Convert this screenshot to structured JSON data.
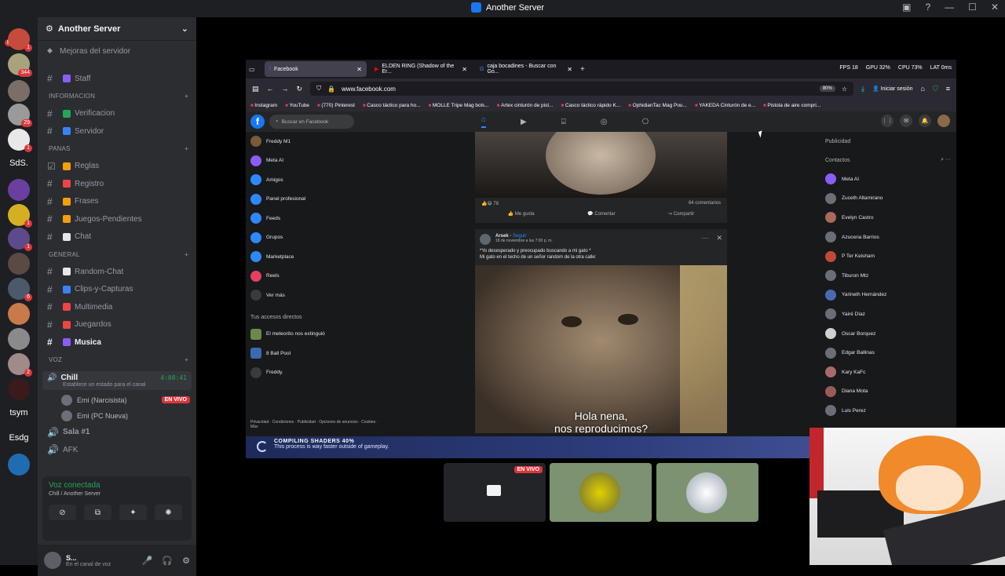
{
  "window": {
    "title": "Another Server"
  },
  "servers": {
    "nuevo_badge": "NUEVO",
    "text_items": [
      "SdS.",
      "tsym",
      "Esdg"
    ],
    "badges": [
      "1",
      "344",
      "29",
      "1",
      "1",
      "1",
      "6",
      "2"
    ]
  },
  "server": {
    "name": "Another Server",
    "boost": "Mejoras del servidor",
    "channels_top": [
      {
        "label": "Staff"
      }
    ],
    "categories": [
      {
        "name": "INFORMACION",
        "channels": [
          {
            "label": "Verificacion"
          },
          {
            "label": "Servidor"
          }
        ]
      },
      {
        "name": "PANAS",
        "channels": [
          {
            "label": "Reglas"
          },
          {
            "label": "Registro"
          },
          {
            "label": "Frases"
          },
          {
            "label": "Juegos-Pendientes"
          },
          {
            "label": "Chat"
          }
        ]
      },
      {
        "name": "GENERAL",
        "channels": [
          {
            "label": "Random-Chat"
          },
          {
            "label": "Clips-y-Capturas"
          },
          {
            "label": "Multimedia"
          },
          {
            "label": "Juegardos"
          },
          {
            "label": "Musica"
          }
        ]
      }
    ],
    "voice_category": "VOZ",
    "voice_channel": {
      "name": "Chill",
      "time": "4:08:41",
      "status": "Establece un estado para el canal"
    },
    "voice_users": [
      {
        "name": "Emi (Narcisista)",
        "live": "EN VIVO"
      },
      {
        "name": "Emi (PC Nueva)"
      }
    ],
    "other_voice": [
      {
        "name": "Sala #1"
      },
      {
        "name": "AFK"
      }
    ]
  },
  "voice_panel": {
    "title": "Voz conectada",
    "sub": "Chill / Another Server"
  },
  "user_panel": {
    "name": "S...",
    "status": "En el canal de voz"
  },
  "browser": {
    "tabs": [
      {
        "label": "Facebook"
      },
      {
        "label": "ELDEN RING (Shadow of the Er..."
      },
      {
        "label": "caja bocadines - Buscar con Go..."
      }
    ],
    "overlay": {
      "fps_label": "FPS",
      "fps": "18",
      "gpu": "GPU 32%",
      "cpu": "CPU 73%",
      "lat": "LAT 0ms"
    },
    "url": "www.facebook.com",
    "zoom": "80%",
    "signin": "Iniciar sesión",
    "bookmarks": [
      "Instagram",
      "YouTube",
      "(770) Pinterest",
      "Casco táctico para ho...",
      "MOLLE Tripe Mag bols...",
      "Artex cinturón de pist...",
      "Casco táctico rápido K...",
      "OphidianTac Mag Pou...",
      "YAKEDA Cinturón de e...",
      "Pistola de aire compri..."
    ]
  },
  "facebook": {
    "search_placeholder": "Buscar en Facebook",
    "left_nav": [
      {
        "label": "Freddy M1"
      },
      {
        "label": "Meta AI"
      },
      {
        "label": "Amigos"
      },
      {
        "label": "Panel profesional"
      },
      {
        "label": "Feeds"
      },
      {
        "label": "Grupos"
      },
      {
        "label": "Marketplace"
      },
      {
        "label": "Reels"
      },
      {
        "label": "Ver más"
      }
    ],
    "shortcuts_title": "Tus accesos directos",
    "shortcuts": [
      {
        "label": "El meteorito nos extinguió"
      },
      {
        "label": "8 Ball Pool"
      },
      {
        "label": "Freddy."
      }
    ],
    "footer": "Privacidad · Condiciones · Publicidad · Opciones de anuncios · Cookies · Más",
    "post1": {
      "reactions": "78",
      "comments": "64 comentarios",
      "like": "Me gusta",
      "comment": "Comentar",
      "share": "Compartir"
    },
    "post2": {
      "author": "Arsek",
      "follow": "Seguir",
      "date": "18 de noviembre a las 7:00 p. m.",
      "text1": "*Yo desesperado y preocupado buscando a mi gato *",
      "text2": "Mi gato en el techo de un señor random de la otra calle:",
      "caption1": "Hola nena,",
      "caption2": "nos reproducimos?"
    },
    "right": {
      "ads": "Publicidad",
      "contacts": "Contactos",
      "list": [
        "Meta AI",
        "Zuceth Altamirano",
        "Evelyn Castro",
        "Azucena Barrios",
        "P Ter Keisham",
        "Tiburon Mtz",
        "Yarineth Hernández",
        "Yairé Díaz",
        "Oscar Borquez",
        "Edgar Ballinas",
        "Kary KaFc",
        "Diana Mota",
        "Luis Perez"
      ]
    }
  },
  "shader": {
    "title": "COMPILING SHADERS 40%",
    "sub": "This process is way faster outside of gameplay."
  },
  "tiles": {
    "live": "EN VIVO"
  }
}
